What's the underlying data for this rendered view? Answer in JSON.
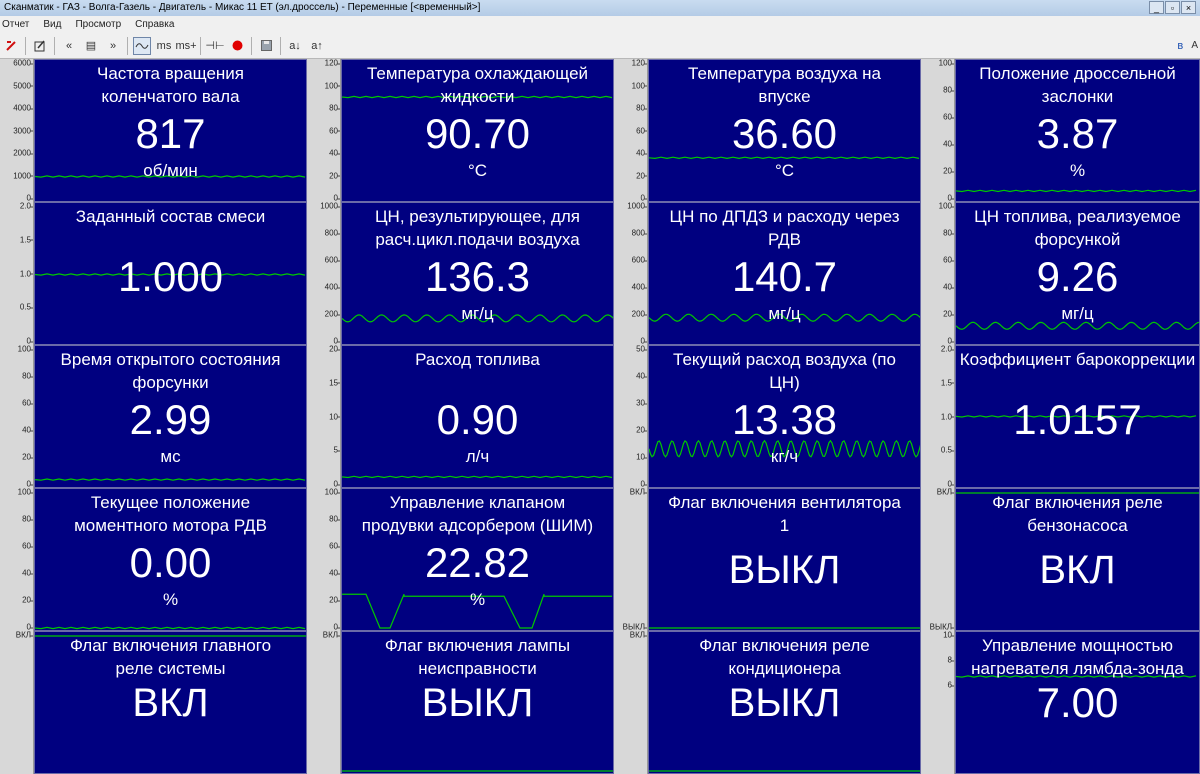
{
  "window": {
    "title": "Сканматик - ГАЗ - Волга-Газель - Двигатель - Микас 11 ET (эл.дроссель) - Переменные [<временный>]",
    "controls": [
      "_",
      "▫",
      "×"
    ]
  },
  "menu": [
    "Отчет",
    "Вид",
    "Просмотр",
    "Справка"
  ],
  "toolbar": {
    "icons": [
      "stop-icon",
      "edit-icon",
      "back-icon",
      "list-icon",
      "forward-icon",
      "graph-icon",
      "ms-icon",
      "ms-plus-icon",
      "record-mode-icon",
      "record-icon",
      "save-icon",
      "font-smaller-icon",
      "font-larger-icon",
      "bluetooth-icon"
    ],
    "labels": {
      "ms": "ms",
      "ms_plus": "ms+",
      "font_small": "a↓",
      "font_large": "a↑",
      "corner": "A"
    }
  },
  "colors": {
    "panel_bg": "#000080",
    "trace": "#00c800",
    "text": "#ffffff"
  },
  "panels": [
    {
      "title": "Частота вращения\nколенчатого вала",
      "value": "817",
      "unit": "об/мин",
      "scale": [
        "6000",
        "5000",
        "4000",
        "3000",
        "2000",
        "1000",
        "0"
      ],
      "scale_max": 6000,
      "trace": "flat",
      "level": 1000
    },
    {
      "title": "Температура охлаждающей\nжидкости",
      "value": "90.70",
      "unit": "°С",
      "scale": [
        "120",
        "100",
        "80",
        "60",
        "40",
        "20",
        "0"
      ],
      "scale_max": 120,
      "trace": "flat",
      "level": 90.7
    },
    {
      "title": "Температура воздуха на\nвпуске",
      "value": "36.60",
      "unit": "°С",
      "scale": [
        "120",
        "100",
        "80",
        "60",
        "40",
        "20",
        "0"
      ],
      "scale_max": 120,
      "trace": "flat",
      "level": 36.6
    },
    {
      "title": "Положение дроссельной\nзаслонки",
      "value": "3.87",
      "unit": "%",
      "scale": [
        "100",
        "80",
        "60",
        "40",
        "20",
        "0"
      ],
      "scale_max": 100,
      "trace": "flat",
      "level": 6
    },
    {
      "title": "Заданный состав смеси",
      "value": "1.000",
      "unit": "",
      "scale": [
        "2.0",
        "1.5",
        "1.0",
        "0.5",
        "0"
      ],
      "scale_max": 2,
      "trace": "flat",
      "level": 1.0
    },
    {
      "title": "ЦН, результирующее, для\nрасч.цикл.подачи воздуха",
      "value": "136.3",
      "unit": "мг/ц",
      "scale": [
        "1000",
        "800",
        "600",
        "400",
        "200",
        "0"
      ],
      "scale_max": 1000,
      "trace": "wave",
      "level": 175
    },
    {
      "title": "ЦН по ДПДЗ и расходу через\nРДВ",
      "value": "140.7",
      "unit": "мг/ц",
      "scale": [
        "1000",
        "800",
        "600",
        "400",
        "200",
        "0"
      ],
      "scale_max": 1000,
      "trace": "wave",
      "level": 180
    },
    {
      "title": "ЦН топлива, реализуемое\nфорсункой",
      "value": "9.26",
      "unit": "мг/ц",
      "scale": [
        "100",
        "80",
        "60",
        "40",
        "20",
        "0"
      ],
      "scale_max": 100,
      "trace": "wave",
      "level": 12
    },
    {
      "title": "Время открытого состояния\nфорсунки",
      "value": "2.99",
      "unit": "мс",
      "scale": [
        "100",
        "80",
        "60",
        "40",
        "20",
        "0"
      ],
      "scale_max": 100,
      "trace": "flat",
      "level": 4
    },
    {
      "title": "Расход топлива",
      "value": "0.90",
      "unit": "л/ч",
      "scale": [
        "20",
        "15",
        "10",
        "5",
        "0"
      ],
      "scale_max": 20,
      "trace": "flat",
      "level": 1.2
    },
    {
      "title": "Текущий расход воздуха (по\nЦН)",
      "value": "13.38",
      "unit": "кг/ч",
      "scale": [
        "50",
        "40",
        "30",
        "20",
        "10",
        "0"
      ],
      "scale_max": 50,
      "trace": "wave-big",
      "level": 13.4
    },
    {
      "title": "Коэффициент барокоррекции",
      "value": "1.0157",
      "unit": "",
      "scale": [
        "2.0",
        "1.5",
        "1.0",
        "0.5",
        "0"
      ],
      "scale_max": 2,
      "trace": "flat",
      "level": 1.0157
    },
    {
      "title": "Текущее положение\nмоментного мотора РДВ",
      "value": "0.00",
      "unit": "%",
      "scale": [
        "100",
        "80",
        "60",
        "40",
        "20",
        "0"
      ],
      "scale_max": 100,
      "trace": "flat",
      "level": 0
    },
    {
      "title": "Управление клапаном\nпродувки адсорбером (ШИМ)",
      "value": "22.82",
      "unit": "%",
      "scale": [
        "100",
        "80",
        "60",
        "40",
        "20",
        "0"
      ],
      "scale_max": 100,
      "trace": "pwm",
      "level": 25
    },
    {
      "title": "Флаг включения вентилятора\n1",
      "value": "ВЫКЛ",
      "unit": "",
      "scale": [
        "ВКЛ",
        "ВЫКЛ"
      ],
      "scale_max": 1,
      "trace": "flag",
      "level": 0
    },
    {
      "title": "Флаг включения реле\nбензонасоса",
      "value": "ВКЛ",
      "unit": "",
      "scale": [
        "ВКЛ",
        "ВЫКЛ"
      ],
      "scale_max": 1,
      "trace": "flag",
      "level": 1
    },
    {
      "title": "Флаг включения главного\nреле системы",
      "value": "ВКЛ",
      "unit": "",
      "scale": [
        "ВКЛ"
      ],
      "scale_max": 1,
      "trace": "flag",
      "level": 1
    },
    {
      "title": "Флаг включения лампы\nнеисправности",
      "value": "ВЫКЛ",
      "unit": "",
      "scale": [
        "ВКЛ"
      ],
      "scale_max": 1,
      "trace": "flag",
      "level": 0
    },
    {
      "title": "Флаг включения реле\nкондиционера",
      "value": "ВЫКЛ",
      "unit": "",
      "scale": [
        "ВКЛ"
      ],
      "scale_max": 1,
      "trace": "flag",
      "level": 0
    },
    {
      "title": "Управление мощностью\nнагревателя лямбда-зонда",
      "value": "7.00",
      "unit": "",
      "scale": [
        "10",
        "8",
        "6"
      ],
      "scale_max": 10,
      "trace": "flat",
      "level": 7
    }
  ]
}
